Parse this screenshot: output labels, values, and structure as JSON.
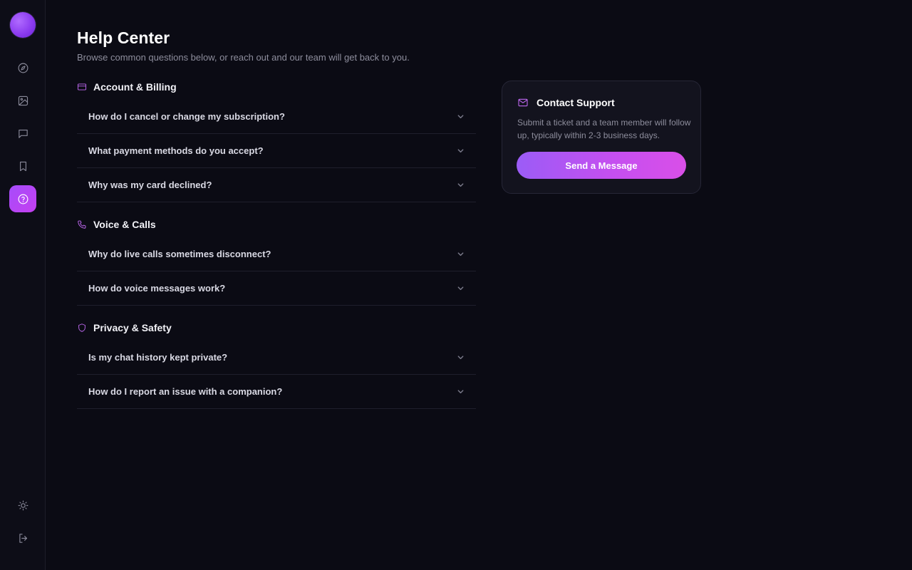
{
  "sidebar": {
    "avatar": "avatar",
    "nav": [
      {
        "name": "explore",
        "icon": "compass-icon"
      },
      {
        "name": "gallery",
        "icon": "image-icon"
      },
      {
        "name": "chats",
        "icon": "chat-icon"
      },
      {
        "name": "saved",
        "icon": "bookmark-icon"
      },
      {
        "name": "help",
        "icon": "help-circle-icon",
        "active": true
      }
    ],
    "bottom": [
      {
        "name": "theme",
        "icon": "sun-icon"
      },
      {
        "name": "logout",
        "icon": "logout-icon"
      }
    ]
  },
  "header": {
    "title": "Help Center",
    "subtitle": "Browse common questions below, or reach out and our team will get back to you."
  },
  "faq": {
    "sections": [
      {
        "title": "Account & Billing",
        "icon": "credit-card-icon",
        "questions": [
          "How do I cancel or change my subscription?",
          "What payment methods do you accept?",
          "Why was my card declined?"
        ]
      },
      {
        "title": "Voice & Calls",
        "icon": "phone-icon",
        "questions": [
          "Why do live calls sometimes disconnect?",
          "How do voice messages work?"
        ]
      },
      {
        "title": "Privacy & Safety",
        "icon": "shield-icon",
        "questions": [
          "Is my chat history kept private?",
          "How do I report an issue with a companion?"
        ]
      }
    ]
  },
  "contact": {
    "title": "Contact Support",
    "icon": "mail-icon",
    "description": "Submit a ticket and a team member will follow up, typically within 2-3 business days.",
    "button_label": "Send a Message"
  },
  "colors": {
    "background": "#0b0b14",
    "accent": "#c069f2",
    "accent_gradient_start": "#9b5cf6",
    "accent_gradient_end": "#d94fe8"
  }
}
